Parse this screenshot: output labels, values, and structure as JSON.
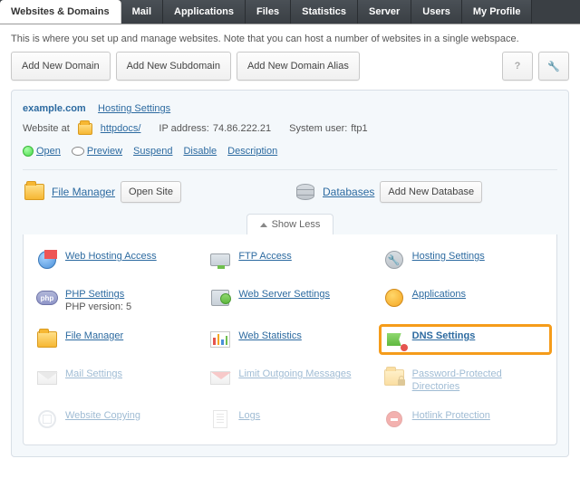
{
  "tabs": [
    "Websites & Domains",
    "Mail",
    "Applications",
    "Files",
    "Statistics",
    "Server",
    "Users",
    "My Profile"
  ],
  "description": "This is where you set up and manage websites. Note that you can host a number of websites in a single webspace.",
  "toolbar": {
    "add_domain": "Add New Domain",
    "add_subdomain": "Add New Subdomain",
    "add_alias": "Add New Domain Alias"
  },
  "domain": {
    "name": "example.com",
    "hosting_settings": "Hosting Settings",
    "website_at": "Website at",
    "folder_link": "httpdocs/",
    "ip_label": "IP address:",
    "ip_value": "74.86.222.21",
    "sysuser_label": "System user:",
    "sysuser_value": "ftp1",
    "actions": {
      "open": "Open",
      "preview": "Preview",
      "suspend": "Suspend",
      "disable": "Disable",
      "description": "Description"
    }
  },
  "section": {
    "file_manager": "File Manager",
    "open_site": "Open Site",
    "databases": "Databases",
    "add_db": "Add New Database"
  },
  "show_less": "Show Less",
  "grid": {
    "web_hosting_access": "Web Hosting Access",
    "ftp_access": "FTP Access",
    "hosting_settings": "Hosting Settings",
    "php_settings": "PHP Settings",
    "php_version": "PHP version: 5",
    "web_server_settings": "Web Server Settings",
    "applications": "Applications",
    "file_manager": "File Manager",
    "web_statistics": "Web Statistics",
    "dns_settings": "DNS Settings",
    "mail_settings": "Mail Settings",
    "limit_outgoing": "Limit Outgoing Messages",
    "password_protected": "Password-Protected Directories",
    "website_copying": "Website Copying",
    "logs": "Logs",
    "hotlink": "Hotlink Protection"
  }
}
